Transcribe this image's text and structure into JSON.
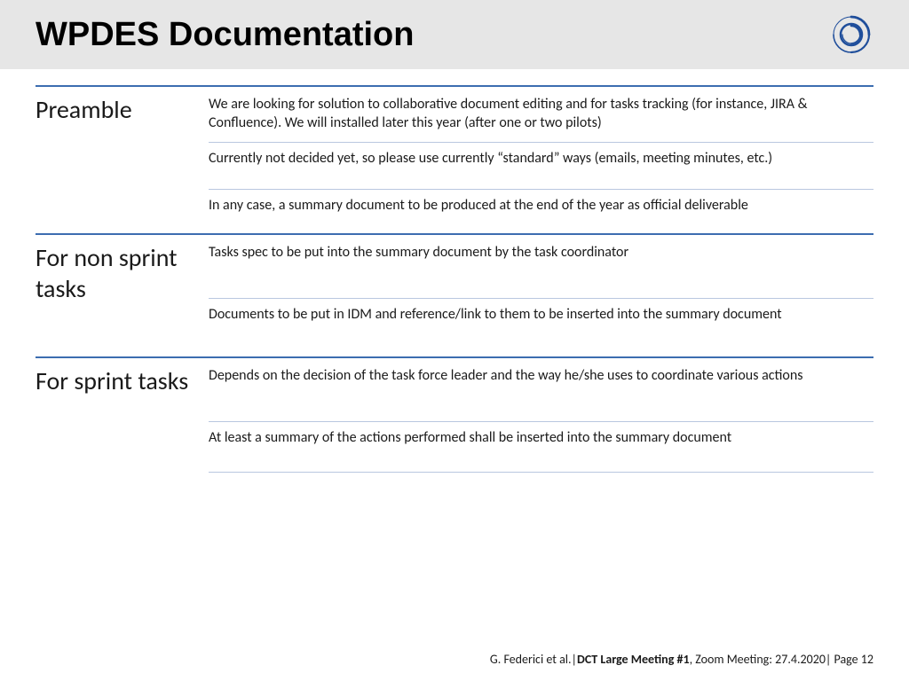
{
  "header": {
    "title": "WPDES Documentation"
  },
  "sections": [
    {
      "label": "Preamble",
      "items": [
        "We are looking for solution to collaborative document editing and for tasks tracking (for instance, JIRA & Confluence). We will installed later this year (after one or two pilots)",
        "Currently not decided yet, so please use currently “standard” ways (emails, meeting minutes, etc.)",
        "In any case, a summary document to be produced at the end of the year as official deliverable"
      ]
    },
    {
      "label": "For non sprint tasks",
      "items": [
        "Tasks spec to be put into the summary document by the task coordinator",
        "Documents to be put in IDM and reference/link to them to be inserted into the summary document"
      ]
    },
    {
      "label": "For sprint tasks",
      "items": [
        "Depends on the decision of the task force leader and the way he/she uses to coordinate various actions",
        "At least a summary of the actions performed shall be inserted into the summary document"
      ]
    }
  ],
  "footer": {
    "author": "G. Federici et al.",
    "meeting_bold": "DCT Large Meeting #1",
    "meeting_rest": ", Zoom Meeting: 27.4.2020",
    "page_label": "Page",
    "page_num": "12"
  }
}
